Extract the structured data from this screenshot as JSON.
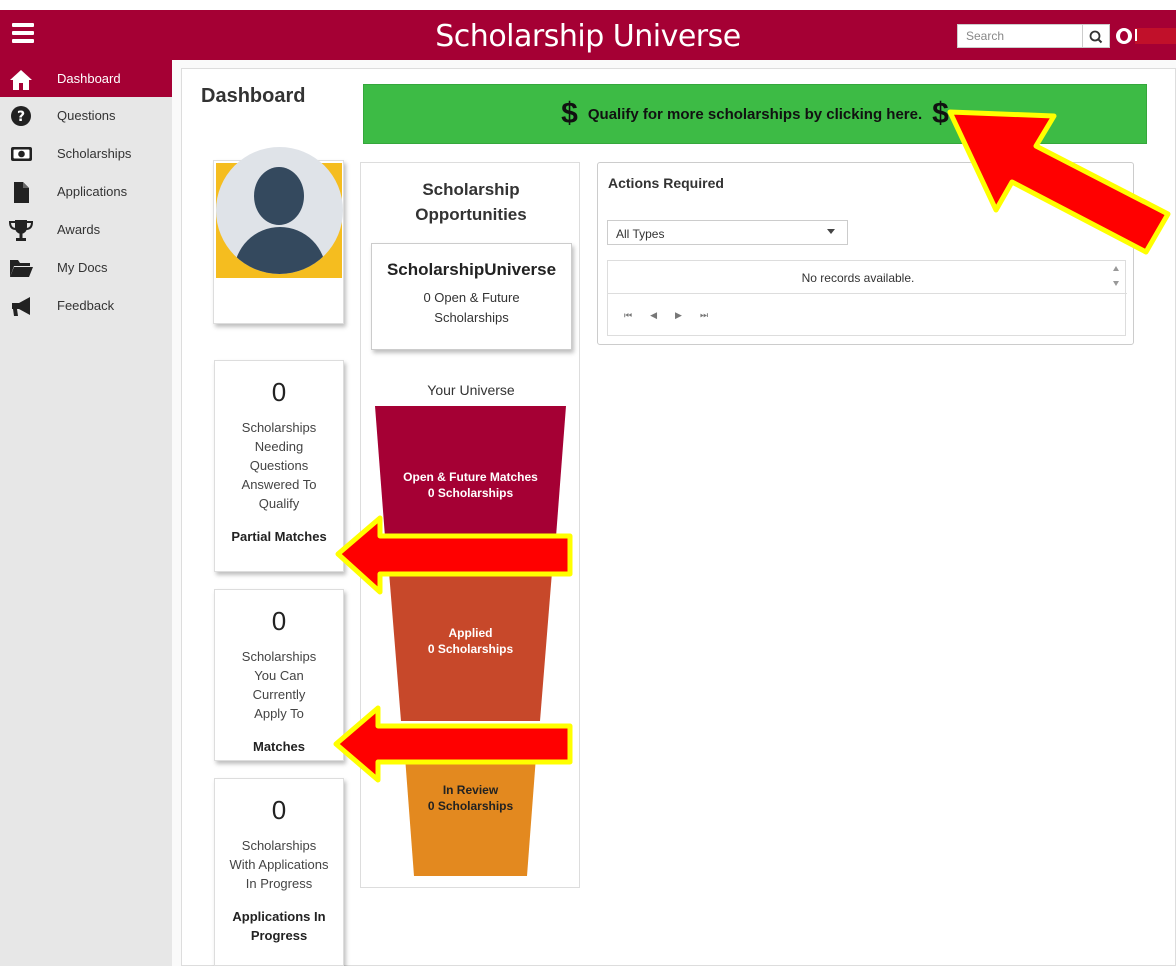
{
  "header": {
    "title": "Scholarship Universe",
    "search_placeholder": "Search"
  },
  "sidebar": {
    "items": [
      {
        "label": "Dashboard",
        "icon": "home-icon",
        "active": true
      },
      {
        "label": "Questions",
        "icon": "question-icon",
        "active": false
      },
      {
        "label": "Scholarships",
        "icon": "money-icon",
        "active": false
      },
      {
        "label": "Applications",
        "icon": "document-icon",
        "active": false
      },
      {
        "label": "Awards",
        "icon": "trophy-icon",
        "active": false
      },
      {
        "label": "My Docs",
        "icon": "folder-icon",
        "active": false
      },
      {
        "label": "Feedback",
        "icon": "megaphone-icon",
        "active": false
      }
    ]
  },
  "main": {
    "page_title": "Dashboard",
    "qualify_banner": {
      "dollar_left": "$",
      "text": "Qualify for more scholarships by clicking here.",
      "dollar_right": "$"
    },
    "stats": [
      {
        "count": "0",
        "description": "Scholarships Needing Questions Answered To Qualify",
        "title": "Partial Matches"
      },
      {
        "count": "0",
        "description": "Scholarships You Can Currently Apply To",
        "title": "Matches"
      },
      {
        "count": "0",
        "description": "Scholarships With Applications In Progress",
        "title": "Applications In Progress"
      }
    ],
    "opportunities": {
      "title": "Scholarship Opportunities",
      "provider_name": "ScholarshipUniverse",
      "provider_count": "0 Open & Future Scholarships",
      "universe_label": "Your Universe",
      "funnel": [
        {
          "label": "Open & Future Matches",
          "count": "0 Scholarships",
          "color": "#a50034"
        },
        {
          "label": "Applied",
          "count": "0 Scholarships",
          "color": "#c7482a"
        },
        {
          "label": "In Review",
          "count": "0 Scholarships",
          "color": "#e3891f"
        }
      ]
    },
    "actions_required": {
      "title": "Actions Required",
      "filter_value": "All Types",
      "empty_text": "No records available.",
      "pager": [
        "⏮",
        "◀",
        "▶",
        "⏭"
      ]
    }
  },
  "colors": {
    "brand": "#a50034",
    "banner": "#3dbb45",
    "sidebar_bg": "#e7e7e7",
    "annotation_arrow": "#ff0000",
    "annotation_outline": "#ffff00"
  }
}
